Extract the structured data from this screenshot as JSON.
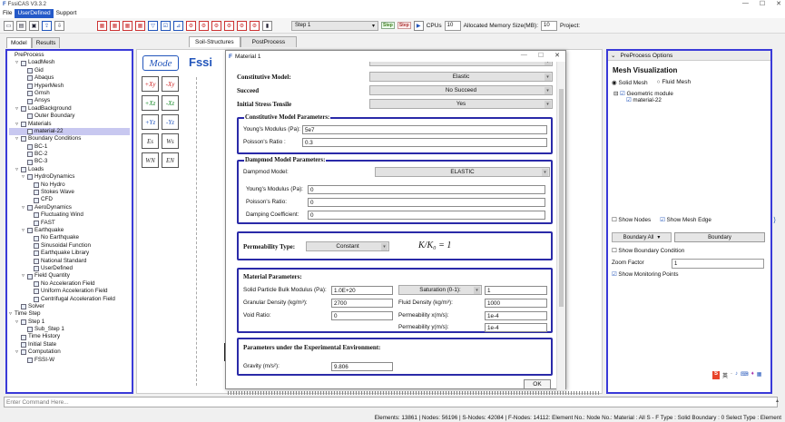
{
  "app": {
    "title": "FssiCAS V3.3.2"
  },
  "menu": [
    "File",
    "UserDefined",
    "Support"
  ],
  "toolbar": {
    "step_select": "Step 1",
    "step_btn1": "Step",
    "step_btn2": "Step",
    "cpus_label": "CPUs",
    "cpus_value": "10",
    "memory_label": "Allocated Memory Size(MB):",
    "memory_value": "10",
    "project_label": "Project:"
  },
  "left_tabs": [
    "Model",
    "Results"
  ],
  "work_tabs": [
    "Soil-Structures",
    "PostProcess"
  ],
  "tree": [
    {
      "label": "PreProcess",
      "indent": 0,
      "exp": ""
    },
    {
      "label": "LoadMesh",
      "indent": 1,
      "exp": "▿"
    },
    {
      "label": "Gid",
      "indent": 2,
      "exp": ""
    },
    {
      "label": "Abaqus",
      "indent": 2,
      "exp": ""
    },
    {
      "label": "HyperMesh",
      "indent": 2,
      "exp": ""
    },
    {
      "label": "Gmsh",
      "indent": 2,
      "exp": ""
    },
    {
      "label": "Ansys",
      "indent": 2,
      "exp": ""
    },
    {
      "label": "LoadBackground",
      "indent": 1,
      "exp": "▿"
    },
    {
      "label": "Outer Boundary",
      "indent": 2,
      "exp": ""
    },
    {
      "label": "Materials",
      "indent": 1,
      "exp": "▿"
    },
    {
      "label": "material-22",
      "indent": 2,
      "exp": "",
      "hl": true
    },
    {
      "label": "Boundary Conditions",
      "indent": 1,
      "exp": "▿"
    },
    {
      "label": "BC-1",
      "indent": 2,
      "exp": ""
    },
    {
      "label": "BC-2",
      "indent": 2,
      "exp": ""
    },
    {
      "label": "BC-3",
      "indent": 2,
      "exp": ""
    },
    {
      "label": "Loads",
      "indent": 1,
      "exp": "▿"
    },
    {
      "label": "HydroDynamics",
      "indent": 2,
      "exp": "▿"
    },
    {
      "label": "No Hydro",
      "indent": 3,
      "exp": ""
    },
    {
      "label": "Stokes Wave",
      "indent": 3,
      "exp": ""
    },
    {
      "label": "CFD",
      "indent": 3,
      "exp": ""
    },
    {
      "label": "AeroDynamics",
      "indent": 2,
      "exp": "▿"
    },
    {
      "label": "Fluctuating Wind",
      "indent": 3,
      "exp": ""
    },
    {
      "label": "FAST",
      "indent": 3,
      "exp": ""
    },
    {
      "label": "Earthquake",
      "indent": 2,
      "exp": "▿"
    },
    {
      "label": "No Earthquake",
      "indent": 3,
      "exp": ""
    },
    {
      "label": "Sinusoidal Function",
      "indent": 3,
      "exp": ""
    },
    {
      "label": "Earthquake Library",
      "indent": 3,
      "exp": ""
    },
    {
      "label": "National Standard",
      "indent": 3,
      "exp": ""
    },
    {
      "label": "UserDefined",
      "indent": 3,
      "exp": ""
    },
    {
      "label": "Field Quantity",
      "indent": 2,
      "exp": "▿"
    },
    {
      "label": "No Acceleration Field",
      "indent": 3,
      "exp": ""
    },
    {
      "label": "Uniform Acceleration Field",
      "indent": 3,
      "exp": ""
    },
    {
      "label": "Centrifugal Acceleration Field",
      "indent": 3,
      "exp": ""
    },
    {
      "label": "Solver",
      "indent": 1,
      "exp": ""
    },
    {
      "label": "Time Step",
      "indent": 0,
      "exp": "▿"
    },
    {
      "label": "Step 1",
      "indent": 1,
      "exp": "▿"
    },
    {
      "label": "Sub_Step 1",
      "indent": 2,
      "exp": ""
    },
    {
      "label": "Time History",
      "indent": 1,
      "exp": ""
    },
    {
      "label": "Initial State",
      "indent": 1,
      "exp": ""
    },
    {
      "label": "Computation",
      "indent": 1,
      "exp": "▿"
    },
    {
      "label": "FSSI-W",
      "indent": 2,
      "exp": ""
    }
  ],
  "mode_btn": "Mode",
  "logo": "Fssi",
  "icon_btns": [
    "+Xy",
    "-Xy",
    "+Xz",
    "-Xz",
    "+Yz",
    "-Yz",
    "Es",
    "Ws",
    "WN",
    "EN"
  ],
  "dialog": {
    "title": "Material 1",
    "constitutive_label": "Constitutive Model:",
    "constitutive_value": "Elastic",
    "succeed_label": "Succeed",
    "succeed_value": "No Succeed",
    "initstress_label": "Initial Stress Tensile",
    "initstress_value": "Yes",
    "cm_group": "Constitutive Model Parameters:",
    "young_label": "Young's Modulus (Pa):",
    "young_value": "5e7",
    "poisson_label": "Poisson's Ratio :",
    "poisson_value": "0.3",
    "dp_group": "Dampmod Model Parameters:",
    "dampmod_label": "Dampmod Model:",
    "dampmod_value": "ELASTIC",
    "dp_young_label": "Young's Modulus (Pa):",
    "dp_young_value": "0",
    "dp_poisson_label": "Poisson's Ratio:",
    "dp_poisson_value": "0",
    "damping_label": "Damping Coefficient:",
    "damping_value": "0",
    "perm_type_label": "Permeability Type:",
    "perm_type_value": "Constant",
    "k_formula": "K/K₀ = 1",
    "mat_group": "Material Parameters:",
    "solid_bulk_label": "Solid Particle Bulk Modulus (Pa):",
    "solid_bulk_value": "1.0E+20",
    "saturation_label": "Saturation (0-1):",
    "saturation_value": "1",
    "granular_label": "Granular Density (kg/m³):",
    "granular_value": "2700",
    "fluid_label": "Fluid Density (kg/m³):",
    "fluid_value": "1000",
    "void_label": "Void Ratio:",
    "void_value": "0",
    "permx_label": "Permeability x(m/s):",
    "permx_value": "1e-4",
    "permy_label": "Permeability y(m/s):",
    "permy_value": "1e-4",
    "exp_group": "Parameters under the Experimental Environment:",
    "gravity_label": "Gravity (m/s²):",
    "gravity_value": "9.806",
    "ok": "OK"
  },
  "right": {
    "header": "PreProcess Options",
    "mesh_vis": "Mesh Visualization",
    "solid_mesh": "Solid Mesh",
    "fluid_mesh": "Fluid Mesh",
    "geom_module": "Geometric module",
    "material": "material-22",
    "show_nodes": "Show Nodes",
    "show_mesh_edge": "Show Mesh Edge",
    "boundary_all": "Boundary All",
    "boundary": "Boundary",
    "show_boundary_cond": "Show Boundary Condition",
    "zoom_label": "Zoom Factor",
    "zoom_value": "1",
    "show_monitoring": "Show Monitoring Points"
  },
  "command_placeholder": "Enter Command Here...",
  "status": "Elements: 13861 | Nodes: 56196 | S-Nodes: 42084 | F-Nodes: 14112: Element No.:   Node No.:   Material :  All    S - F Type :  Solid    Boundary :  0    Select Type :  Element"
}
